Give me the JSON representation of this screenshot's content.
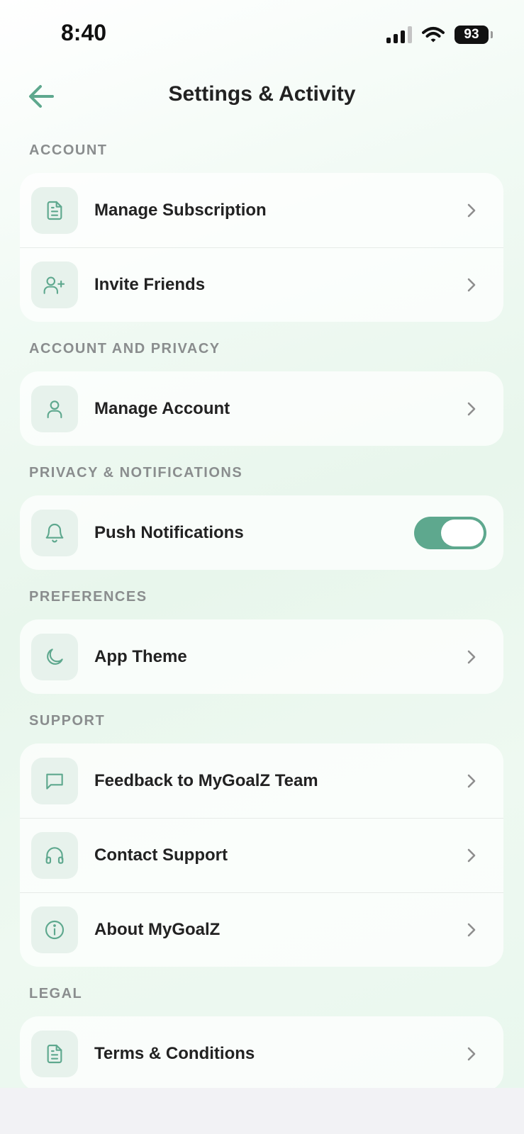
{
  "status_bar": {
    "time": "8:40",
    "battery": "93"
  },
  "header": {
    "title": "Settings & Activity"
  },
  "colors": {
    "accent": "#5ea88e",
    "icon_bg": "#e7f2ec",
    "section_title": "#8a8d8e"
  },
  "sections": [
    {
      "title": "ACCOUNT",
      "items": [
        {
          "label": "Manage Subscription",
          "icon": "document-icon"
        },
        {
          "label": "Invite Friends",
          "icon": "user-plus-icon"
        }
      ]
    },
    {
      "title": "ACCOUNT AND PRIVACY",
      "items": [
        {
          "label": "Manage Account",
          "icon": "user-icon"
        }
      ]
    },
    {
      "title": "PRIVACY & NOTIFICATIONS",
      "items": [
        {
          "label": "Push Notifications",
          "icon": "bell-icon",
          "toggle": true
        }
      ]
    },
    {
      "title": "PREFERENCES",
      "items": [
        {
          "label": "App Theme",
          "icon": "moon-icon"
        }
      ]
    },
    {
      "title": "SUPPORT",
      "items": [
        {
          "label": "Feedback to MyGoalZ Team",
          "icon": "message-icon"
        },
        {
          "label": "Contact Support",
          "icon": "headphones-icon"
        },
        {
          "label": "About MyGoalZ",
          "icon": "info-icon"
        }
      ]
    },
    {
      "title": "LEGAL",
      "items": [
        {
          "label": "Terms & Conditions",
          "icon": "document-icon"
        }
      ]
    }
  ]
}
